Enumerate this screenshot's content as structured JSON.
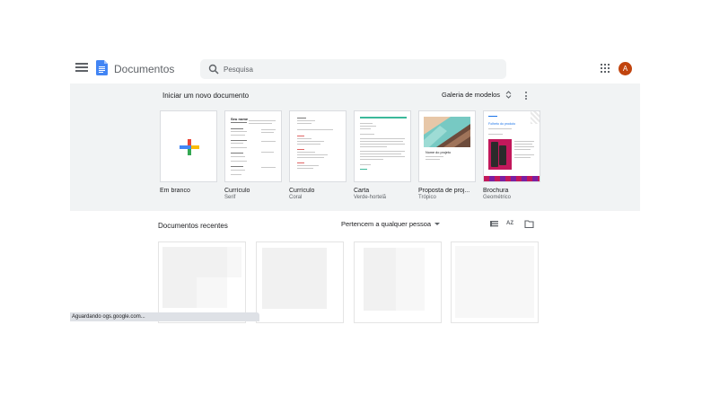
{
  "header": {
    "title": "Documentos",
    "search_placeholder": "Pesquisa",
    "avatar_letter": "A",
    "avatar_color": "#c1440e"
  },
  "templates": {
    "section_title": "Iniciar um novo documento",
    "gallery_label": "Galeria de modelos",
    "items": [
      {
        "name": "Em branco",
        "subtitle": ""
      },
      {
        "name": "Currículo",
        "subtitle": "Serif",
        "thumb_heading": "Seu nome"
      },
      {
        "name": "Currículo",
        "subtitle": "Coral"
      },
      {
        "name": "Carta",
        "subtitle": "Verde-hortelã"
      },
      {
        "name": "Proposta de proj...",
        "subtitle": "Trópico",
        "thumb_heading": "Nome do projeto"
      },
      {
        "name": "Brochura",
        "subtitle": "Geométrico",
        "thumb_heading": "Folheto do produto"
      }
    ]
  },
  "recent": {
    "title": "Documentos recentes",
    "owner_filter": "Pertencem a qualquer pessoa",
    "sort_label": "AZ"
  },
  "status_bar": {
    "text": "Aguardando ogs.google.com..."
  },
  "colors": {
    "section_bg": "#f1f3f4",
    "docs_blue": "#4285f4",
    "plus_blue": "#4285f4",
    "plus_red": "#ea4335",
    "plus_yellow": "#fbbc04",
    "plus_green": "#34a853"
  }
}
